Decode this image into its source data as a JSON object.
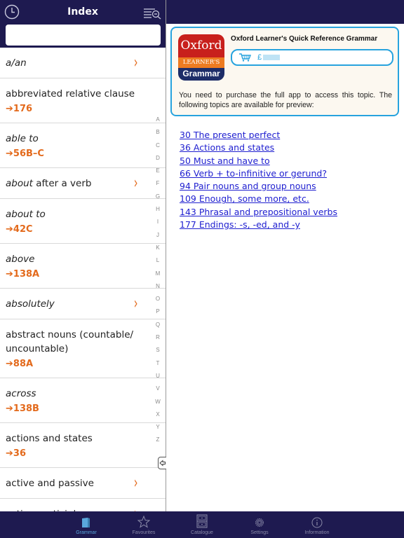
{
  "left_panel": {
    "title": "Index",
    "search": {
      "value": "",
      "placeholder": ""
    },
    "icons": {
      "history": "clock-icon",
      "search_list": "list-search-icon"
    },
    "items": [
      {
        "title_italic": "a/an",
        "title_rest": "",
        "ref": "",
        "has_chevron": true
      },
      {
        "title_italic": "",
        "title_rest": "abbreviated relative clause",
        "ref": "➔176",
        "has_chevron": false
      },
      {
        "title_italic": "able to",
        "title_rest": "",
        "ref": "➔56B–C",
        "has_chevron": false
      },
      {
        "title_italic": "about",
        "title_rest": " after a verb",
        "ref": "",
        "has_chevron": true
      },
      {
        "title_italic": "about to",
        "title_rest": "",
        "ref": "➔42C",
        "has_chevron": false
      },
      {
        "title_italic": "above",
        "title_rest": "",
        "ref": "➔138A",
        "has_chevron": false
      },
      {
        "title_italic": "absolutely",
        "title_rest": "",
        "ref": "",
        "has_chevron": true
      },
      {
        "title_italic": "",
        "title_rest": "abstract nouns (countable/ uncountable)",
        "ref": "➔88A",
        "has_chevron": false
      },
      {
        "title_italic": "across",
        "title_rest": "",
        "ref": "➔138B",
        "has_chevron": false
      },
      {
        "title_italic": "",
        "title_rest": "actions and states",
        "ref": "➔36",
        "has_chevron": false
      },
      {
        "title_italic": "",
        "title_rest": "active and passive",
        "ref": "",
        "has_chevron": true
      },
      {
        "title_italic": "",
        "title_rest": "active participle",
        "ref": "",
        "has_chevron": true
      }
    ],
    "chevron_glyph": "›",
    "alphabet": [
      "A",
      "B",
      "C",
      "D",
      "E",
      "F",
      "G",
      "H",
      "I",
      "J",
      "K",
      "L",
      "M",
      "N",
      "O",
      "P",
      "Q",
      "R",
      "S",
      "T",
      "U",
      "V",
      "W",
      "X",
      "Y",
      "Z"
    ]
  },
  "right_panel": {
    "promo": {
      "app_icon": {
        "line1": "Oxford",
        "line2": "LEARNER'S",
        "line3": "Grammar"
      },
      "title": "Oxford Learner's Quick Reference Grammar",
      "price_prefix": "£",
      "price_masked": true,
      "message": "You need to purchase the full app to access this topic. The following topics are available for preview:"
    },
    "preview_topics": [
      "30 The present perfect",
      "36 Actions and states",
      "50 Must and have to",
      "66 Verb + to-infinitive or gerund?",
      "94 Pair nouns and group nouns",
      "109 Enough, some more, etc.",
      "143 Phrasal and prepositional verbs",
      "177 Endings: -s, -ed, and -y"
    ]
  },
  "tabbar": {
    "tabs": [
      {
        "label": "Grammar",
        "icon": "book-icon",
        "active": true
      },
      {
        "label": "Favourites",
        "icon": "star-icon",
        "active": false
      },
      {
        "label": "Catalogue",
        "icon": "cabinet-icon",
        "active": false
      },
      {
        "label": "Settings",
        "icon": "gear-icon",
        "active": false
      },
      {
        "label": "Information",
        "icon": "info-icon",
        "active": false
      }
    ]
  },
  "colors": {
    "header_bg": "#1e1a50",
    "accent_orange": "#e36a1c",
    "accent_blue": "#27a3de",
    "link": "#2020d0",
    "tab_active": "#5aa7dc"
  }
}
